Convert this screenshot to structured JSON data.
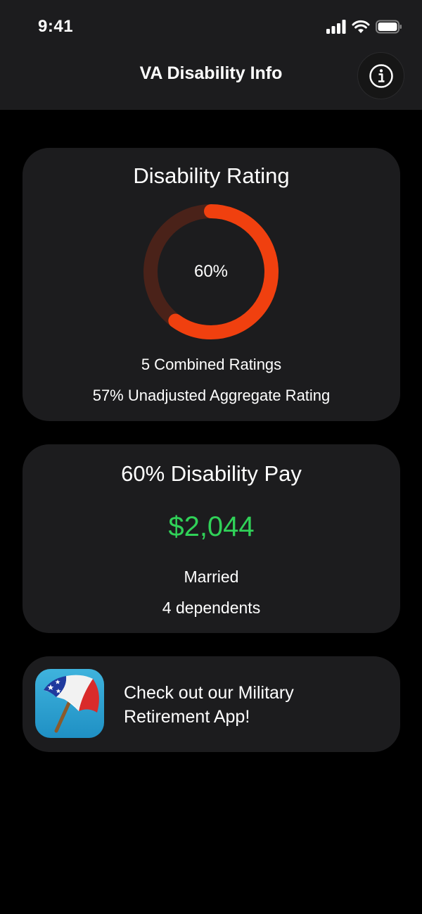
{
  "status_bar": {
    "time": "9:41",
    "icons": [
      "signal-icon",
      "wifi-icon",
      "battery-icon"
    ]
  },
  "nav": {
    "title": "VA Disability Info",
    "info_icon": "info-icon"
  },
  "rating_card": {
    "title": "Disability Rating",
    "rating_label": "60%",
    "rating_fraction": 0.6,
    "combined_ratings": "5 Combined Ratings",
    "unadjusted_aggregate": "57% Unadjusted Aggregate Rating",
    "colors": {
      "progress": "#f0400f",
      "track": "#4a2219"
    }
  },
  "pay_card": {
    "title": "60% Disability Pay",
    "amount": "$2,044",
    "marital_status": "Married",
    "dependents": "4 dependents",
    "colors": {
      "amount": "#30d158"
    }
  },
  "promo_card": {
    "icon": "umbrella-app-icon",
    "text": "Check out our Military Retirement App!"
  },
  "colors": {
    "background": "#000000",
    "card": "#1c1c1e"
  }
}
